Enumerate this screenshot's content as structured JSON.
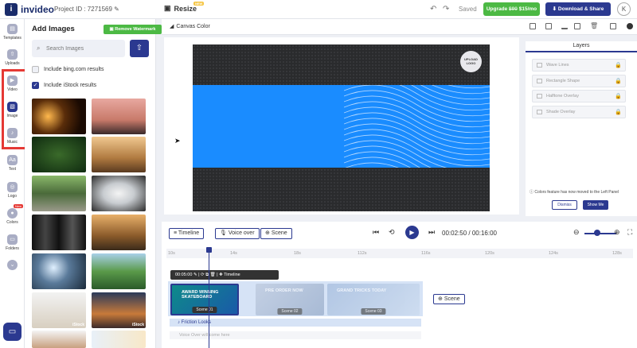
{
  "app": {
    "name": "invideo",
    "project_id": "Project ID : 7271569",
    "mode": "Resize",
    "mode_badge": "NEW"
  },
  "topbar": {
    "saved": "Saved",
    "upgrade_label": "Upgrade",
    "upgrade_old_price": "$90",
    "upgrade_price": "$15/mo",
    "download_label": "Download & Share",
    "avatar_initial": "K"
  },
  "nav": {
    "items": [
      {
        "label": "Templates",
        "icon": "template-icon"
      },
      {
        "label": "Uploads",
        "icon": "upload-icon"
      },
      {
        "label": "Video",
        "icon": "video-icon"
      },
      {
        "label": "Image",
        "icon": "image-icon"
      },
      {
        "label": "Music",
        "icon": "music-icon"
      },
      {
        "label": "Text",
        "icon": "text-icon",
        "glyph": "Aa"
      },
      {
        "label": "Logo",
        "icon": "logo-icon"
      },
      {
        "label": "Colors",
        "icon": "colors-icon",
        "badge": "New"
      },
      {
        "label": "Folders",
        "icon": "folder-icon"
      }
    ]
  },
  "images_panel": {
    "title": "Add Images",
    "remove_watermark": "Remove Watermark",
    "search_placeholder": "Search Images",
    "include_bing": "Include bing.com results",
    "include_istock": "Include iStock results",
    "istock_label": "iStock"
  },
  "canvas": {
    "canvas_color_label": "Canvas Color",
    "logo_seal_text": "UPLOAD LOGO",
    "colors": {
      "background": "#2a2b2d",
      "band": "#1a8cff"
    }
  },
  "layers": {
    "tab": "Layers",
    "items": [
      "Wave Lines",
      "Rectangle Shape",
      "Halftone Overlay",
      "Shade Overlay"
    ],
    "notice": "Colors feature has now moved to the Left Panel",
    "dismiss": "Dismiss",
    "show_me": "Show Me"
  },
  "timeline": {
    "timeline_btn": "Timeline",
    "voiceover_btn": "Voice over",
    "scene_btn": "Scene",
    "current_time": "00:02:50",
    "separator": "/",
    "total_time": "00:16:00",
    "ticks": [
      "10s",
      "14s",
      "18s",
      "112s",
      "116s",
      "120s",
      "124s",
      "128s"
    ],
    "clip_toolbar_time": "00:05:00",
    "clip_toolbar_label": "Timeline",
    "scenes": [
      {
        "label": "Scene 01",
        "text": "AWARD WINNING SKATEBOARD"
      },
      {
        "label": "Scene 02",
        "text": "PRE ORDER NOW"
      },
      {
        "label": "Scene 03",
        "text": "GRAND TRICKS TODAY"
      }
    ],
    "add_scene": "Scene",
    "audio_track": "Friction Looks",
    "voice_track": "Voice Over will come here"
  }
}
